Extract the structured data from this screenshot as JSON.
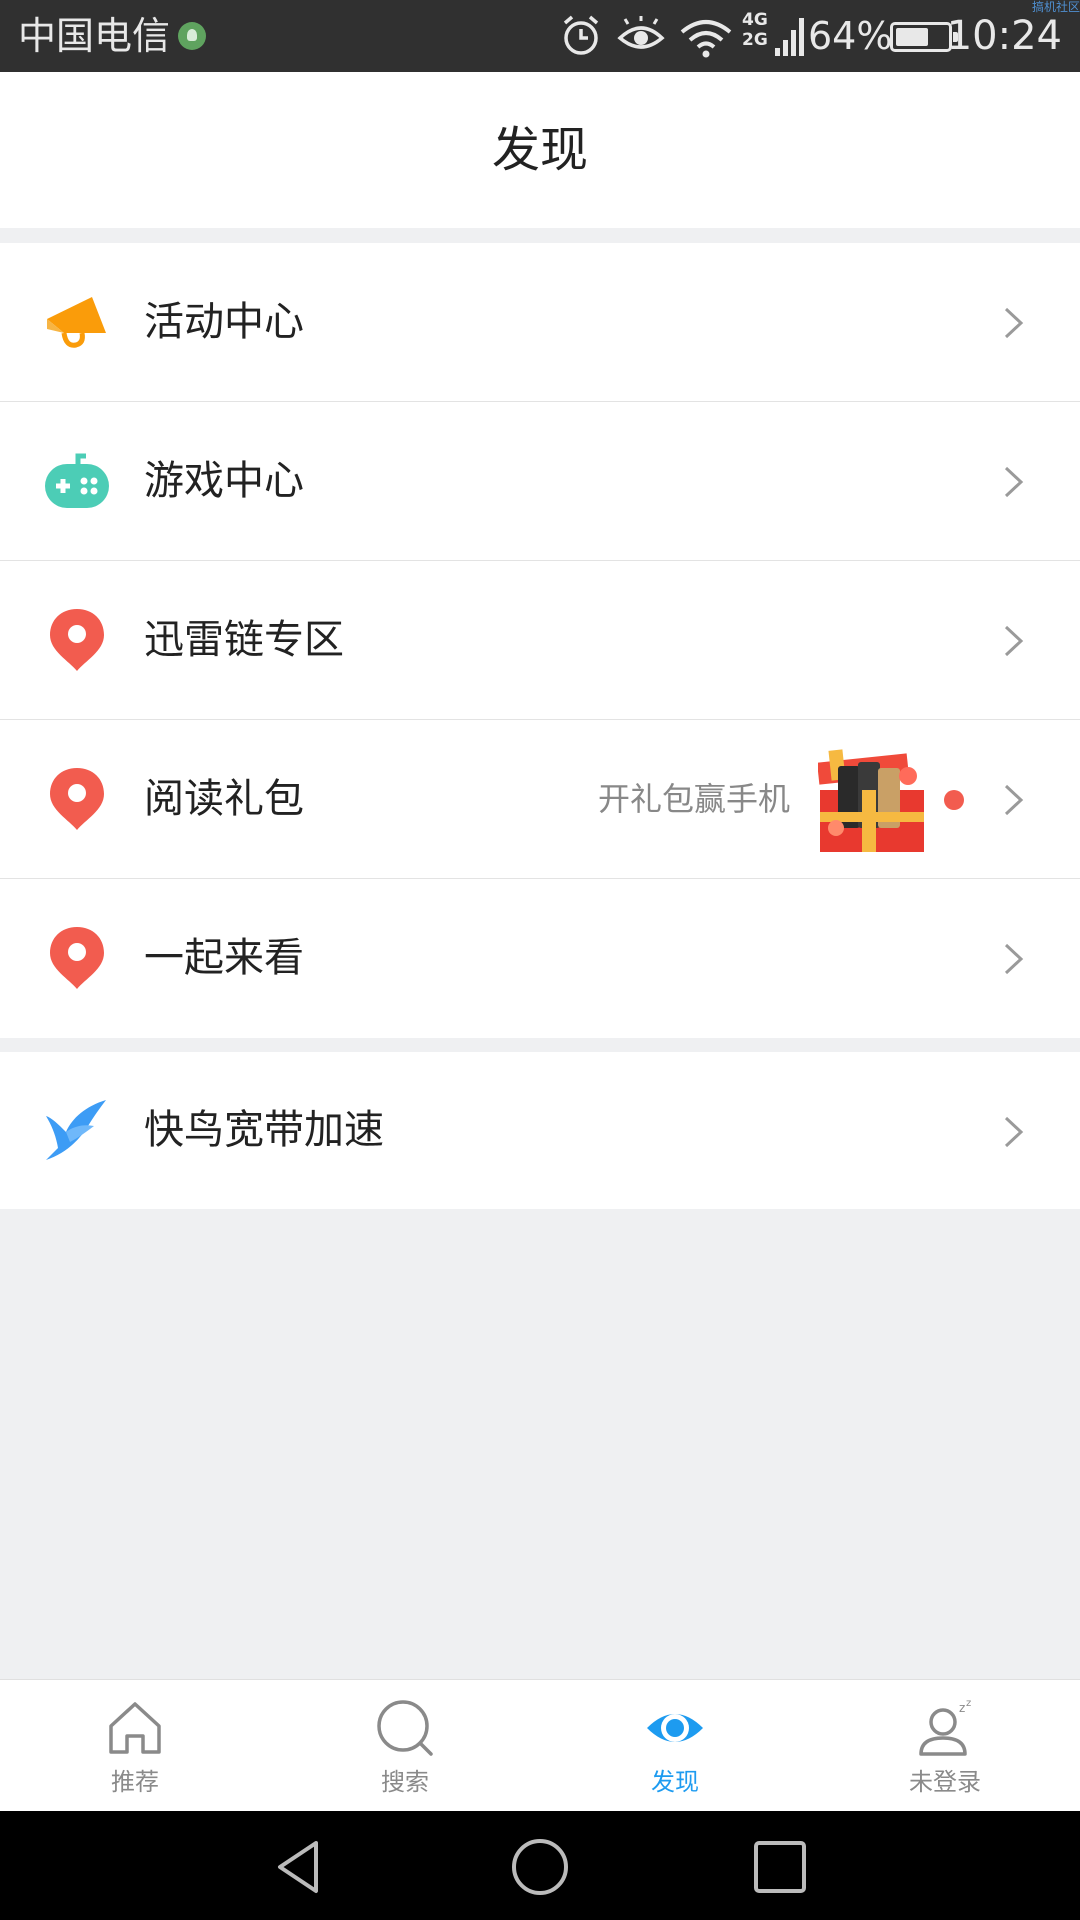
{
  "status_bar": {
    "carrier": "中国电信",
    "network_top": "4G",
    "network_bottom": "2G",
    "battery": "64%",
    "battery_level": 0.64,
    "time": "10:24",
    "watermark": "搞机社区"
  },
  "header": {
    "title": "发现"
  },
  "menu": {
    "activity_center": {
      "label": "活动中心",
      "icon": "megaphone-icon",
      "color": "#fa9c0a"
    },
    "game_center": {
      "label": "游戏中心",
      "icon": "gamepad-icon",
      "color": "#4ccdb6"
    },
    "thunder_chain": {
      "label": "迅雷链专区",
      "icon": "map-pin-icon",
      "color": "#f25c4f"
    },
    "reading_gift": {
      "label": "阅读礼包",
      "icon": "map-pin-icon",
      "color": "#f25c4f",
      "promo": "开礼包赢手机"
    },
    "watch_together": {
      "label": "一起来看",
      "icon": "map-pin-icon",
      "color": "#f25c4f"
    },
    "broadband_boost": {
      "label": "快鸟宽带加速",
      "icon": "bird-icon",
      "color": "#3d9cf5"
    }
  },
  "tabs": {
    "recommend": {
      "label": "推荐",
      "icon": "home-icon"
    },
    "search": {
      "label": "搜索",
      "icon": "search-icon"
    },
    "discover": {
      "label": "发现",
      "icon": "eye-icon",
      "active": true
    },
    "profile": {
      "label": "未登录",
      "icon": "user-sleep-icon"
    }
  },
  "accent_color": "#1d9bf0"
}
